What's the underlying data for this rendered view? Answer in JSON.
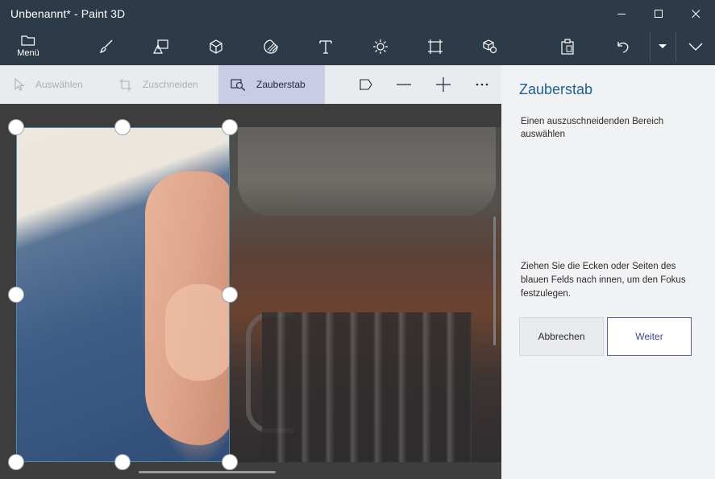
{
  "window": {
    "title": "Unbenannt* - Paint 3D"
  },
  "toolbar": {
    "menu_label": "Menü",
    "tools": [
      {
        "icon": "brush-icon"
      },
      {
        "icon": "shapes-2d-icon"
      },
      {
        "icon": "shapes-3d-icon"
      },
      {
        "icon": "stickers-icon"
      },
      {
        "icon": "text-icon",
        "glyph": "T"
      },
      {
        "icon": "effects-icon"
      },
      {
        "icon": "canvas-icon"
      },
      {
        "icon": "3d-library-icon"
      }
    ],
    "right_actions": [
      {
        "icon": "paste-icon"
      },
      {
        "icon": "undo-icon"
      },
      {
        "icon": "history-dropdown-icon"
      },
      {
        "icon": "expand-icon"
      }
    ]
  },
  "subtoolbar": {
    "select_label": "Auswählen",
    "crop_label": "Zuschneiden",
    "magic_select_label": "Zauberstab",
    "icons": [
      "flag-icon",
      "zoom-out-icon",
      "zoom-in-icon",
      "more-icon"
    ]
  },
  "panel": {
    "title": "Zauberstab",
    "description": "Einen auszuschneidenden Bereich auswählen",
    "hint": "Ziehen Sie die Ecken oder Seiten des blauen Felds nach innen, um den Fokus festzulegen.",
    "cancel_label": "Abbrechen",
    "next_label": "Weiter"
  },
  "colors": {
    "title_bar": "#2d3a47",
    "subbar": "#e9ecef",
    "active_tool": "#c9cbe7",
    "panel_bg": "#f1f2f4",
    "panel_title": "#1f5e99",
    "selection_border": "#4a90b0",
    "canvas_bg": "#3d3d3d"
  }
}
